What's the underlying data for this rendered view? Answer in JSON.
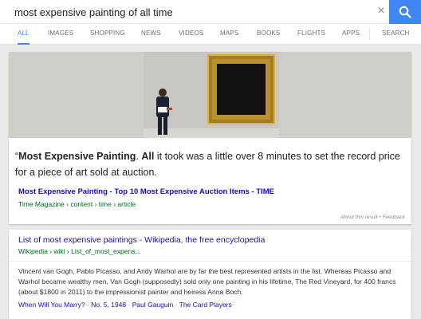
{
  "search": {
    "query": "most expensive painting of all time",
    "clear_icon": "×"
  },
  "tabs": [
    "ALL",
    "IMAGES",
    "SHOPPING",
    "NEWS",
    "VIDEOS",
    "MAPS",
    "BOOKS",
    "FLIGHTS",
    "APPS",
    "SEARCH"
  ],
  "featured": {
    "quote_mark": "“",
    "snippet_bold_1": "Most Expensive Painting",
    "snippet_mid": ". ",
    "snippet_bold_2": "All",
    "snippet_rest": " it took was a little over 8 minutes to set the record price for a piece of art sold at auction.",
    "title": "Most Expensive Painting - Top 10 Most Expensive Auction Items - TIME",
    "url": "Time Magazine › content › time › article",
    "about": "About this result",
    "feedback": "Feedback"
  },
  "result2": {
    "title": "List of most expensive paintings - Wikipedia, the free encyclopedia",
    "url": "Wikipedia › wiki › List_of_most_expens...",
    "snippet": "Vincent van Gogh, Pablo Picasso, and Andy Warhol are by far the best represented artists in the list. Whereas Picasso and Warhol became wealthy men, Van Gogh (supposedly) sold only one painting in his lifetime, The Red Vineyard, for 400 francs (about $1800 in 2011) to the impressionist painter and heiress Anna Boch.",
    "links": [
      "When Will You Marry?",
      "No. 5, 1948",
      "Paul Gauguin",
      "The Card Players"
    ]
  },
  "colors": {
    "accent": "#4285f4",
    "link": "#1a0dab",
    "url_green": "#006621"
  }
}
